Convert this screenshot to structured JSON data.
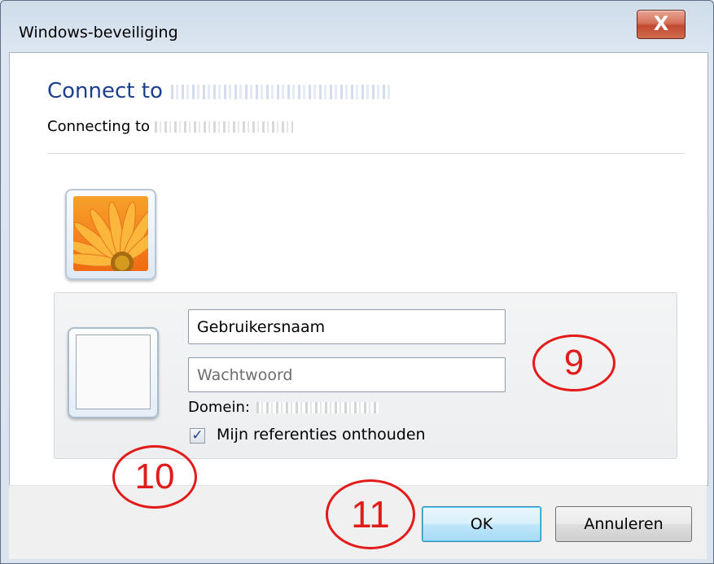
{
  "window": {
    "title": "Windows-beveiliging",
    "close_symbol": "X",
    "close_icon": "close-icon"
  },
  "header": {
    "connect_label": "Connect to",
    "connecting_label": "Connecting to"
  },
  "credentials": {
    "username_value": "Gebruikersnaam",
    "password_placeholder": "Wachtwoord",
    "domain_label": "Domein:",
    "remember_checked": true,
    "remember_check_mark": "✓",
    "remember_label": "Mijn referenties onthouden"
  },
  "buttons": {
    "ok_label": "OK",
    "cancel_label": "Annuleren"
  },
  "annotations": {
    "callout_9": "9",
    "callout_10": "10",
    "callout_11": "11",
    "color": "#e31a1a"
  },
  "icons": {
    "user_picture": "flower-user-icon",
    "credential_picture": "blank-user-icon"
  }
}
